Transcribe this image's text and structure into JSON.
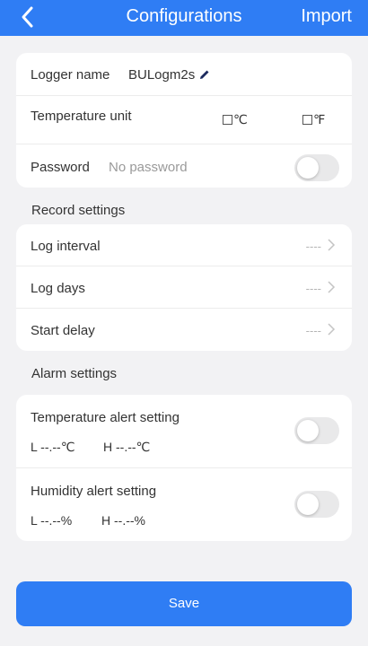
{
  "header": {
    "title": "Configurations",
    "import_label": "Import"
  },
  "basic": {
    "logger_name_label": "Logger name",
    "logger_name_value": "BULogm2s",
    "temp_unit_label": "Temperature unit",
    "unit_c": "℃",
    "unit_f": "℉",
    "password_label": "Password",
    "password_value": "No password"
  },
  "record": {
    "section_title": "Record settings",
    "items": [
      {
        "label": "Log interval",
        "value": "----"
      },
      {
        "label": "Log days",
        "value": "----"
      },
      {
        "label": "Start delay",
        "value": "----"
      }
    ]
  },
  "alarm": {
    "section_title": "Alarm settings",
    "temp_label": "Temperature alert setting",
    "temp_low": "L --.--℃",
    "temp_high": "H --.--℃",
    "hum_label": "Humidity alert setting",
    "hum_low": "L --.--%",
    "hum_high": "H --.--%"
  },
  "save_label": "Save",
  "colors": {
    "accent": "#2f7df4",
    "background": "#f2f2f4",
    "toggle_off": "#e9e9ea"
  }
}
